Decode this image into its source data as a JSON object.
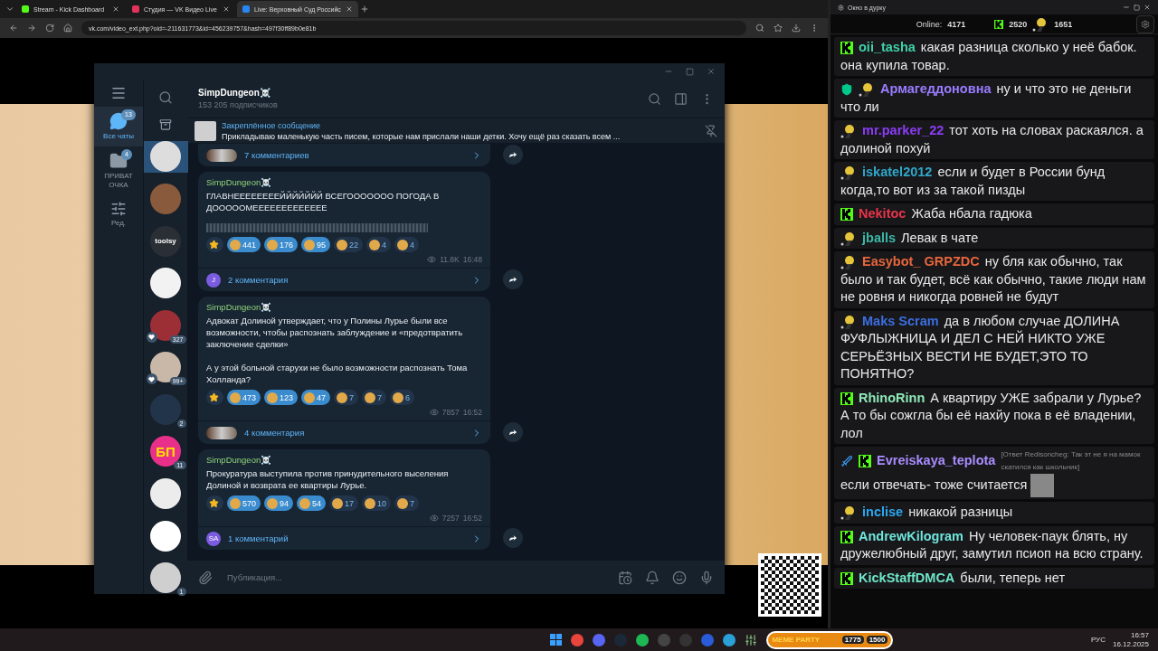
{
  "browser": {
    "tabs": [
      {
        "title": "Stream - Kick Dashboard",
        "kind": "kick",
        "selected": false
      },
      {
        "title": "Студия — VK Видео Live",
        "kind": "studio",
        "selected": false
      },
      {
        "title": "Live: Верховный Суд Российс",
        "kind": "vk",
        "selected": true
      }
    ],
    "address": "vk.com/video_ext.php?oid=-211631773&id=456239757&hash=497f30ff89b0e81b"
  },
  "telegram": {
    "folders": [
      {
        "label": "Все чаты",
        "badge": "13",
        "kind": "chats",
        "selected": true
      },
      {
        "label": "ПРИВАТ ОЧКА",
        "badge": "4",
        "kind": "folder",
        "selected": false
      },
      {
        "label": "Ред.",
        "kind": "edit",
        "selected": false
      }
    ],
    "chats": [
      {
        "selected": true,
        "heart": false
      },
      {
        "selected": false,
        "heart": false
      },
      {
        "label": "toolsy",
        "selected": false,
        "heart": false
      },
      {
        "selected": false,
        "heart": false
      },
      {
        "badge": "327",
        "selected": false,
        "heart": true
      },
      {
        "badge": "99+",
        "selected": false,
        "heart": true
      },
      {
        "badge": "2",
        "selected": false,
        "heart": false
      },
      {
        "label": "БП",
        "badge": "11",
        "selected": false,
        "heart": false
      },
      {
        "selected": false,
        "heart": false
      },
      {
        "selected": false,
        "heart": false
      },
      {
        "badge": "1",
        "selected": false,
        "heart": false
      }
    ],
    "channel": {
      "name": "SimpDungeon☠️",
      "subscribers": "153 205 подписчиков"
    },
    "pinned": {
      "title": "Закреплённое сообщение",
      "text": "Прикладываю маленькую часть писем, которые нам прислали наши детки.   Хочу ещё раз сказать всем ..."
    },
    "previous_comments": "7 комментариев",
    "posts": [
      {
        "author": "SimpDungeon☠️",
        "paragraphs": [
          "ГЛАВНЕЕЕЕЕЕЕЕЙЙЙЙЙЙЙ ВСЕГООООООО ПОГОДА В ДОООООМЕЕЕЕЕЕЕЕЕЕЕЕЕ"
        ],
        "spoiler": true,
        "reactions": [
          {
            "kind": "star",
            "selected": false
          },
          {
            "kind": "emoji",
            "count": "441",
            "selected": true
          },
          {
            "kind": "emoji",
            "count": "176",
            "selected": true
          },
          {
            "kind": "emoji",
            "count": "95",
            "selected": true
          },
          {
            "kind": "emoji",
            "count": "22",
            "selected": false
          },
          {
            "kind": "emoji",
            "count": "4",
            "selected": false
          },
          {
            "kind": "emoji",
            "count": "4",
            "selected": false
          }
        ],
        "views": "11.8K",
        "time": "16:48",
        "comments": "2 комментария",
        "commenter": "J"
      },
      {
        "author": "SimpDungeon☠️",
        "paragraphs": [
          "Адвокат Долиной утверждает, что у Полины Лурье были все возможности, чтобы распознать заблуждение и «предотвратить заключение сделки»",
          "А у этой больной старухи не было возможности распознать Тома Холланда?"
        ],
        "spoiler": false,
        "reactions": [
          {
            "kind": "star",
            "selected": false
          },
          {
            "kind": "emoji",
            "count": "473",
            "selected": true
          },
          {
            "kind": "emoji",
            "count": "123",
            "selected": true
          },
          {
            "kind": "emoji",
            "count": "47",
            "selected": true
          },
          {
            "kind": "emoji",
            "count": "7",
            "selected": false
          },
          {
            "kind": "emoji",
            "count": "7",
            "selected": false
          },
          {
            "kind": "emoji",
            "count": "6",
            "selected": false
          }
        ],
        "views": "7857",
        "time": "16:52",
        "comments": "4 комментария"
      },
      {
        "author": "SimpDungeon☠️",
        "paragraphs": [
          "Прокуратура выступила против принудительного выселения Долиной и возврата ее квартиры Лурье."
        ],
        "spoiler": false,
        "reactions": [
          {
            "kind": "star",
            "selected": false
          },
          {
            "kind": "emoji",
            "count": "570",
            "selected": true
          },
          {
            "kind": "emoji",
            "count": "94",
            "selected": true
          },
          {
            "kind": "emoji",
            "count": "54",
            "selected": true
          },
          {
            "kind": "emoji",
            "count": "17",
            "selected": false
          },
          {
            "kind": "emoji",
            "count": "10",
            "selected": false
          },
          {
            "kind": "emoji",
            "count": "7",
            "selected": false
          }
        ],
        "views": "7257",
        "time": "16:52",
        "comments": "1 комментарий",
        "commenter": "SA"
      }
    ],
    "composer": {
      "placeholder": "Публикация..."
    }
  },
  "chat": {
    "title": "Окно в дурку",
    "online_label": "Online:",
    "online": "4171",
    "kick_count": "2520",
    "other_count": "1651",
    "messages": [
      {
        "badges": [
          {
            "kind": "kick"
          }
        ],
        "user": "oii_tasha",
        "color": "#3fd0a8",
        "text": "какая разница сколько у неё бабок. она купила товар."
      },
      {
        "badges": [
          {
            "kind": "mod"
          },
          {
            "kind": "avatar"
          }
        ],
        "user": "Армагеддоновна",
        "color": "#9a7cff",
        "text": "ну и что это не деньги что ли"
      },
      {
        "badges": [
          {
            "kind": "avatar"
          }
        ],
        "user": "mr.parker_22",
        "color": "#8b3cf5",
        "text": "тот хоть на словах раскаялся. а долиной похуй"
      },
      {
        "badges": [
          {
            "kind": "avatar"
          }
        ],
        "user": "iskatel2012",
        "color": "#2fa7c9",
        "text": "если и будет в России бунд когда,то вот из за такой пизды"
      },
      {
        "badges": [
          {
            "kind": "kick"
          }
        ],
        "user": "Nekitoc",
        "color": "#e8344a",
        "text": "Жаба нбала гадюка"
      },
      {
        "badges": [
          {
            "kind": "avatar"
          }
        ],
        "user": "jballs",
        "color": "#3bb8a6",
        "text": "Левак в чате"
      },
      {
        "badges": [
          {
            "kind": "avatar"
          }
        ],
        "user": "Easybot_ GRPZDC",
        "color": "#e8663c",
        "text": "ну бля как обычно, так было и так будет, всё как обычно, такие люди нам не ровня и никогда ровней не будут"
      },
      {
        "badges": [
          {
            "kind": "avatar"
          }
        ],
        "user": "Maks Scram",
        "color": "#3c6ee0",
        "text": "да в любом случае ДОЛИНА ФУФЛЫЖНИЦА И ДЕЛ С НЕЙ НИКТО УЖЕ СЕРЬЁЗНЫХ ВЕСТИ НЕ БУДЕТ,ЭТО ТО ПОНЯТНО?"
      },
      {
        "badges": [
          {
            "kind": "kick"
          }
        ],
        "user": "RhinoRinn",
        "color": "#8fe8b8",
        "text": "А квартиру УЖЕ забрали у Лурье? А то бы сожгла бы её нахйу пока в её владении, лол"
      },
      {
        "badges": [
          {
            "kind": "sword"
          },
          {
            "kind": "kick"
          }
        ],
        "user": "Evreiskaya_teplota",
        "color": "#a98cff",
        "reply": "[Ответ Redisoncheg: Так эт не я на мамок скатился как школьник]",
        "text": "если отвечать- тоже считается",
        "emote": true
      },
      {
        "badges": [
          {
            "kind": "avatar"
          }
        ],
        "user": "inclise",
        "color": "#2aa8f0",
        "text": "никакой разницы"
      },
      {
        "badges": [
          {
            "kind": "kick"
          }
        ],
        "user": "AndrewKilogram",
        "color": "#6fe6dc",
        "text": "Ну человек-паук блять, ну дружелюбный друг, замутил псиоп на всю страну."
      },
      {
        "badges": [
          {
            "kind": "kick"
          }
        ],
        "user": "KickStaffDMCA",
        "color": "#6fe6c8",
        "text": "были, теперь нет"
      }
    ]
  },
  "taskbar": {
    "widget": {
      "title": "MEME PARTY",
      "value": "1775",
      "goal": "1500"
    },
    "language": "РУС",
    "time": "16:57",
    "date": "16.12.2025"
  }
}
